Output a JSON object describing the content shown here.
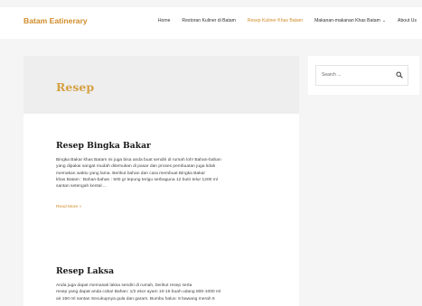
{
  "header": {
    "logo": "Batam Eatinerary",
    "nav": [
      {
        "label": "Home",
        "active": false,
        "dropdown": false
      },
      {
        "label": "Restoran Kuliner di Batam",
        "active": false,
        "dropdown": false
      },
      {
        "label": "Resep Kuliner Khas Batam",
        "active": true,
        "dropdown": false
      },
      {
        "label": "Makanan-makanan Khas Batam",
        "active": false,
        "dropdown": true
      },
      {
        "label": "About Us",
        "active": false,
        "dropdown": false
      }
    ],
    "accent_color": "#d18b2a"
  },
  "main": {
    "archive_title": "Resep",
    "posts": [
      {
        "title": "Resep Bingka Bakar",
        "excerpt_lines": [
          "Bingka Bakar khas Batam ini juga bisa anda buat sendiri di rumah loh! Bahan-bahan",
          "yang dipakai sangat mudah ditemukan di pasar dan proses pembuatan juga tidak",
          "memakan waktu yang lama. Berikut bahan dan cara membuat Bingka Bakar",
          "khas Batam : Bahan-bahan : 500 gr tepung terigu serbaguna 12 butir telur 1200 ml",
          "santan setengah kental ..."
        ],
        "read_more": "Read More »"
      },
      {
        "title": "Resep Laksa",
        "excerpt_lines": [
          "Anda juga dapat memasak laksa sendiri di rumah, berikut resep serta",
          "resep yang dapat anda coba! Bahan: 1/2 ekor ayam 10-15 buah udang 800-1000 ml",
          "air 150 ml santan Secukupnya gula dan garam. Bumbu halus: 8 bawang merah 6"
        ]
      }
    ]
  },
  "sidebar": {
    "search_placeholder": "Search ..."
  }
}
